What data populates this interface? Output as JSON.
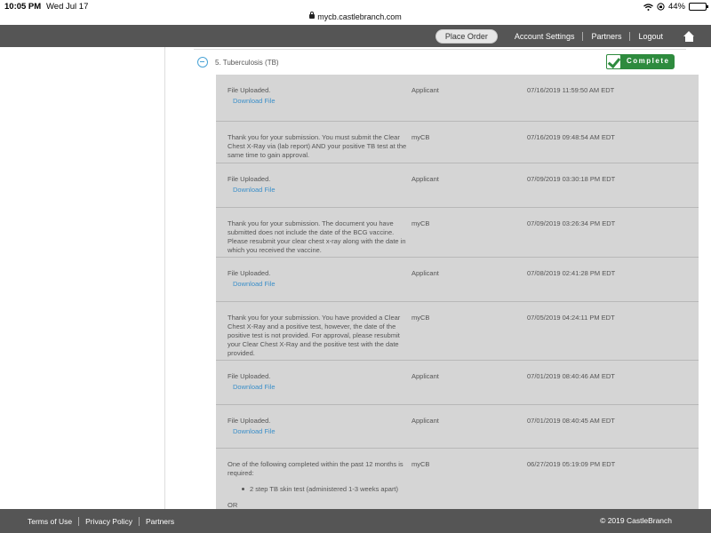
{
  "status_bar": {
    "time": "10:05 PM",
    "date": "Wed Jul 17",
    "url": "mycb.castlebranch.com",
    "battery": "44%",
    "battery_level": 0.44
  },
  "nav": {
    "place_order": "Place Order",
    "account_settings": "Account Settings",
    "partners": "Partners",
    "logout": "Logout"
  },
  "section": {
    "title": "5. Tuberculosis (TB)",
    "status": "Complete"
  },
  "history": [
    {
      "message": "File Uploaded.",
      "link": "Download File",
      "by": "Applicant",
      "date": "07/16/2019 11:59:50 AM EDT"
    },
    {
      "message": "Thank you for your submission. You must submit the Clear Chest X-Ray via (lab report) AND your positive TB test at the same time to gain approval.",
      "by": "myCB",
      "date": "07/16/2019 09:48:54 AM EDT"
    },
    {
      "message": "File Uploaded.",
      "link": "Download File",
      "by": "Applicant",
      "date": "07/09/2019 03:30:18 PM EDT"
    },
    {
      "message": "Thank you for your submission. The document you have submitted does not include the date of the BCG vaccine. Please resubmit your clear chest x-ray along with the date in which you received the vaccine.",
      "by": "myCB",
      "date": "07/09/2019 03:26:34 PM EDT"
    },
    {
      "message": "File Uploaded.",
      "link": "Download File",
      "by": "Applicant",
      "date": "07/08/2019 02:41:28 PM EDT"
    },
    {
      "message": "Thank you for your submission. You have provided a Clear Chest X-Ray and a positive test, however, the date of the positive test is not provided. For approval, please resubmit your Clear Chest X-Ray and the positive test with the date provided.",
      "by": "myCB",
      "date": "07/05/2019 04:24:11 PM EDT"
    },
    {
      "message": "File Uploaded.",
      "link": "Download File",
      "by": "Applicant",
      "date": "07/01/2019 08:40:46 AM EDT"
    },
    {
      "message": "File Uploaded.",
      "link": "Download File",
      "by": "Applicant",
      "date": "07/01/2019 08:40:45 AM EDT"
    },
    {
      "message": "One of the following completed within the past 12 months is required:",
      "bullet": "2 step TB skin test (administered 1-3 weeks apart)",
      "or": "OR",
      "by": "myCB",
      "date": "06/27/2019 05:19:09 PM EDT"
    }
  ],
  "footer": {
    "terms": "Terms of Use",
    "privacy": "Privacy Policy",
    "partners": "Partners",
    "copyright": "© 2019 CastleBranch"
  }
}
